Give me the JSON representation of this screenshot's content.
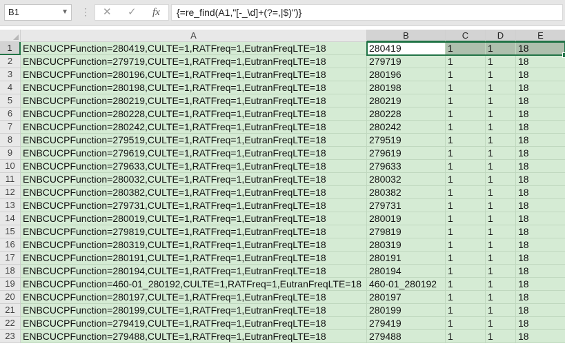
{
  "formula_bar": {
    "name_box": "B1",
    "formula": "{=re_find(A1,\"[-_\\d]+(?=,|$)\")}",
    "icons": [
      "cancel-icon",
      "enter-icon",
      "fx-icon"
    ],
    "fx_label": "fx"
  },
  "columns": [
    "A",
    "B",
    "C",
    "D",
    "E"
  ],
  "rows": [
    [
      "ENBCUCPFunction=280419,CULTE=1,RATFreq=1,EutranFreqLTE=18",
      "280419",
      "1",
      "1",
      "18"
    ],
    [
      "ENBCUCPFunction=279719,CULTE=1,RATFreq=1,EutranFreqLTE=18",
      "279719",
      "1",
      "1",
      "18"
    ],
    [
      "ENBCUCPFunction=280196,CULTE=1,RATFreq=1,EutranFreqLTE=18",
      "280196",
      "1",
      "1",
      "18"
    ],
    [
      "ENBCUCPFunction=280198,CULTE=1,RATFreq=1,EutranFreqLTE=18",
      "280198",
      "1",
      "1",
      "18"
    ],
    [
      "ENBCUCPFunction=280219,CULTE=1,RATFreq=1,EutranFreqLTE=18",
      "280219",
      "1",
      "1",
      "18"
    ],
    [
      "ENBCUCPFunction=280228,CULTE=1,RATFreq=1,EutranFreqLTE=18",
      "280228",
      "1",
      "1",
      "18"
    ],
    [
      "ENBCUCPFunction=280242,CULTE=1,RATFreq=1,EutranFreqLTE=18",
      "280242",
      "1",
      "1",
      "18"
    ],
    [
      "ENBCUCPFunction=279519,CULTE=1,RATFreq=1,EutranFreqLTE=18",
      "279519",
      "1",
      "1",
      "18"
    ],
    [
      "ENBCUCPFunction=279619,CULTE=1,RATFreq=1,EutranFreqLTE=18",
      "279619",
      "1",
      "1",
      "18"
    ],
    [
      "ENBCUCPFunction=279633,CULTE=1,RATFreq=1,EutranFreqLTE=18",
      "279633",
      "1",
      "1",
      "18"
    ],
    [
      "ENBCUCPFunction=280032,CULTE=1,RATFreq=1,EutranFreqLTE=18",
      "280032",
      "1",
      "1",
      "18"
    ],
    [
      "ENBCUCPFunction=280382,CULTE=1,RATFreq=1,EutranFreqLTE=18",
      "280382",
      "1",
      "1",
      "18"
    ],
    [
      "ENBCUCPFunction=279731,CULTE=1,RATFreq=1,EutranFreqLTE=18",
      "279731",
      "1",
      "1",
      "18"
    ],
    [
      "ENBCUCPFunction=280019,CULTE=1,RATFreq=1,EutranFreqLTE=18",
      "280019",
      "1",
      "1",
      "18"
    ],
    [
      "ENBCUCPFunction=279819,CULTE=1,RATFreq=1,EutranFreqLTE=18",
      "279819",
      "1",
      "1",
      "18"
    ],
    [
      "ENBCUCPFunction=280319,CULTE=1,RATFreq=1,EutranFreqLTE=18",
      "280319",
      "1",
      "1",
      "18"
    ],
    [
      "ENBCUCPFunction=280191,CULTE=1,RATFreq=1,EutranFreqLTE=18",
      "280191",
      "1",
      "1",
      "18"
    ],
    [
      "ENBCUCPFunction=280194,CULTE=1,RATFreq=1,EutranFreqLTE=18",
      "280194",
      "1",
      "1",
      "18"
    ],
    [
      "ENBCUCPFunction=460-01_280192,CULTE=1,RATFreq=1,EutranFreqLTE=18",
      "460-01_280192",
      "1",
      "1",
      "18"
    ],
    [
      "ENBCUCPFunction=280197,CULTE=1,RATFreq=1,EutranFreqLTE=18",
      "280197",
      "1",
      "1",
      "18"
    ],
    [
      "ENBCUCPFunction=280199,CULTE=1,RATFreq=1,EutranFreqLTE=18",
      "280199",
      "1",
      "1",
      "18"
    ],
    [
      "ENBCUCPFunction=279419,CULTE=1,RATFreq=1,EutranFreqLTE=18",
      "279419",
      "1",
      "1",
      "18"
    ],
    [
      "ENBCUCPFunction=279488,CULTE=1,RATFreq=1,EutranFreqLTE=18",
      "279488",
      "1",
      "1",
      "18"
    ]
  ],
  "selection": {
    "active_cell": "B1",
    "range": "B1:E1"
  },
  "colors": {
    "cell_fill": "#d5ebd4",
    "accent": "#217346",
    "header_bg": "#e8e8e8"
  }
}
